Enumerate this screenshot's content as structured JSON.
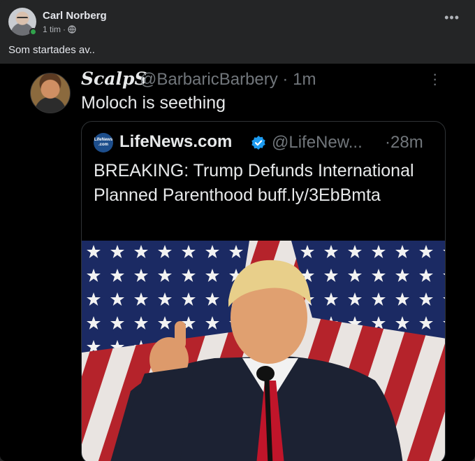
{
  "post": {
    "author": "Carl Norberg",
    "time": "1 tim",
    "separator": "·",
    "text": "Som startades av..",
    "more_icon": "more-horizontal-icon",
    "privacy_icon": "globe-icon",
    "online_color": "#31a24c"
  },
  "tweet": {
    "name": "ScalpS",
    "handle": "@BarbaricBarbery · 1m",
    "menu_icon": "more-vertical-icon",
    "text": "Moloch is seething"
  },
  "quoted": {
    "logo_text": "LifeNews .com",
    "name": "LifeNews.com",
    "verified_color": "#1d9bf0",
    "handle": "@LifeNew...",
    "time": "·28m",
    "body": "BREAKING: Trump Defunds International Planned Parenthood buff.ly/3EbBmta",
    "image": "photo-trump-thumbs-up-flag"
  }
}
